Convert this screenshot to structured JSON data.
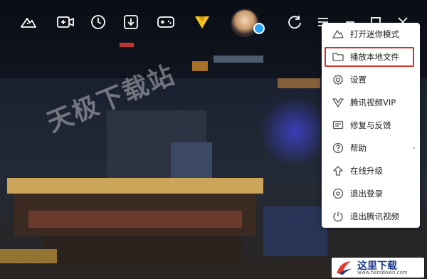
{
  "watermark": "天极下载站",
  "toolbar": {
    "icons": [
      "cloud-icon",
      "video-add-icon",
      "history-icon",
      "download-icon",
      "game-icon",
      "vip-icon",
      "refresh-icon",
      "menu-icon",
      "minimize-icon",
      "maximize-icon",
      "close-icon"
    ]
  },
  "menu": {
    "items": [
      {
        "label": "打开迷你模式",
        "icon": "mini-mode-icon"
      },
      {
        "label": "播放本地文件",
        "icon": "folder-icon"
      },
      {
        "label": "设置",
        "icon": "settings-icon"
      },
      {
        "label": "腾讯视频VIP",
        "icon": "vip-icon"
      },
      {
        "label": "修复与反馈",
        "icon": "feedback-icon"
      },
      {
        "label": "帮助",
        "icon": "help-icon",
        "arrow": "›"
      },
      {
        "label": "在线升级",
        "icon": "upgrade-icon"
      },
      {
        "label": "退出登录",
        "icon": "logout-icon"
      },
      {
        "label": "退出腾讯视频",
        "icon": "power-icon"
      }
    ]
  },
  "logo": {
    "text": "这里下载",
    "url": "www.herodown.com"
  },
  "colors": {
    "highlight": "#d0312d",
    "vip_gold": "#f5c518",
    "qq_blue": "#2aa1ff"
  }
}
